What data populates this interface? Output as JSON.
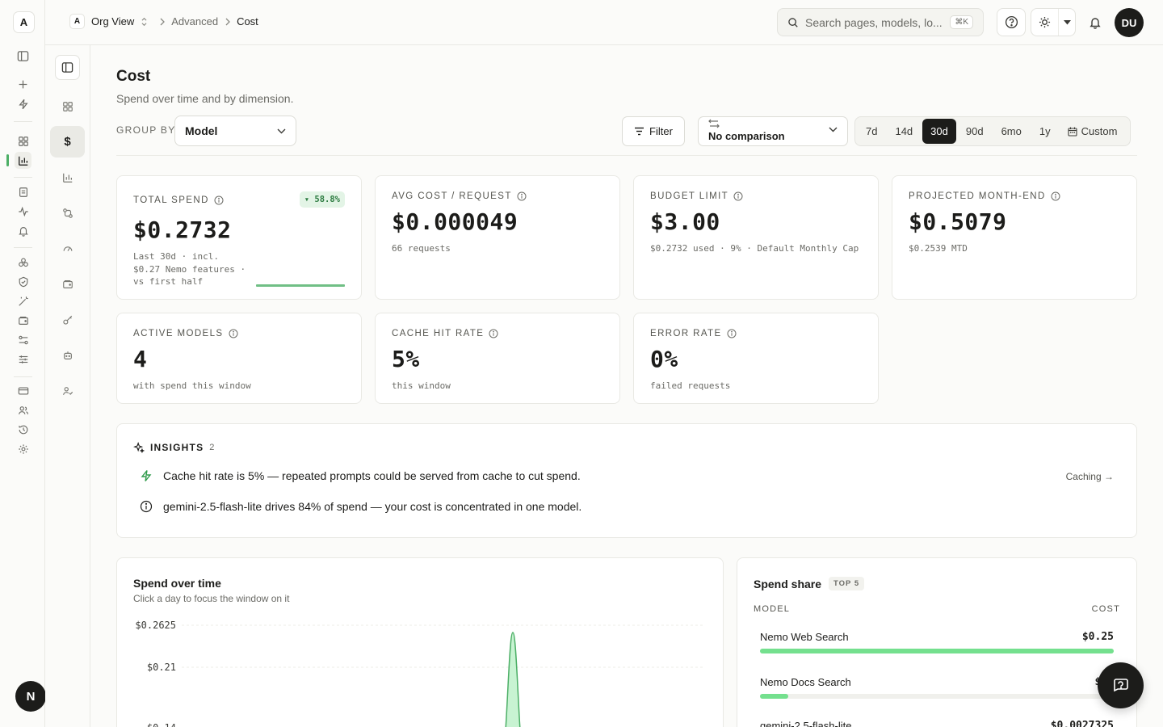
{
  "rail": {
    "logo": "A",
    "avatar_initial": "N"
  },
  "breadcrumb": {
    "org_badge": "A",
    "org": "Org View",
    "section": "Advanced",
    "current": "Cost"
  },
  "search": {
    "placeholder": "Search pages, models, lo...",
    "shortcut": "⌘K"
  },
  "user": {
    "initials": "DU"
  },
  "page": {
    "title": "Cost",
    "subtitle": "Spend over time and by dimension."
  },
  "toolbar": {
    "group_by_label": "GROUP BY",
    "group_by_value": "Model",
    "filter_label": "Filter",
    "comparison_value": "No comparison",
    "ranges": [
      "7d",
      "14d",
      "30d",
      "90d",
      "6mo",
      "1y"
    ],
    "active_range": "30d",
    "custom_label": "Custom"
  },
  "kpis": {
    "total_spend": {
      "label": "TOTAL SPEND",
      "value": "$0.2732",
      "badge": "▾ 58.8%",
      "note_line1": "Last 30d · incl.",
      "note_line2": "$0.27 Nemo features ·",
      "note_line3": "vs first half"
    },
    "avg_cost": {
      "label": "AVG COST / REQUEST",
      "value": "$0.000049",
      "note": "66 requests"
    },
    "budget": {
      "label": "BUDGET LIMIT",
      "value": "$3.00",
      "note": "$0.2732 used · 9% · Default Monthly Cap"
    },
    "projected": {
      "label": "PROJECTED MONTH-END",
      "value": "$0.5079",
      "note": "$0.2539 MTD"
    },
    "active_models": {
      "label": "ACTIVE MODELS",
      "value": "4",
      "note": "with spend this window"
    },
    "cache_hit": {
      "label": "CACHE HIT RATE",
      "value": "5%",
      "note": "this window"
    },
    "error_rate": {
      "label": "ERROR RATE",
      "value": "0%",
      "note": "failed requests"
    }
  },
  "insights": {
    "title": "INSIGHTS",
    "count": "2",
    "items": [
      {
        "text": "Cache hit rate is 5% — repeated prompts could be served from cache to cut spend.",
        "link": "Caching →"
      },
      {
        "text": "gemini-2.5-flash-lite drives 84% of spend — your cost is concentrated in one model."
      }
    ]
  },
  "spend_over_time": {
    "title": "Spend over time",
    "subtitle": "Click a day to focus the window on it",
    "y_ticks": [
      "$0.2625",
      "$0.21",
      "$0.14"
    ]
  },
  "spend_share": {
    "title": "Spend share",
    "badge": "TOP 5",
    "col_model": "MODEL",
    "col_cost": "COST",
    "rows": [
      {
        "label": "Nemo Web Search",
        "value": "$0.25",
        "share": 1.0
      },
      {
        "label": "Nemo Docs Search",
        "value": "$0.",
        "share": 0.08
      },
      {
        "label": "gemini-2.5-flash-lite",
        "value": "$0.0027325",
        "share": 0.01
      }
    ]
  },
  "chart_data": {
    "type": "area",
    "title": "Spend over time",
    "y_ticks": [
      "$0.2625",
      "$0.21",
      "$0.14"
    ],
    "ylim": [
      0,
      0.2625
    ],
    "series": [
      {
        "values_note": "single spike near end of window",
        "peak": 0.2625
      }
    ]
  },
  "colors": {
    "accent": "#4caf66",
    "bar_fill": "#74e08e",
    "dark": "#1c1c1a"
  }
}
